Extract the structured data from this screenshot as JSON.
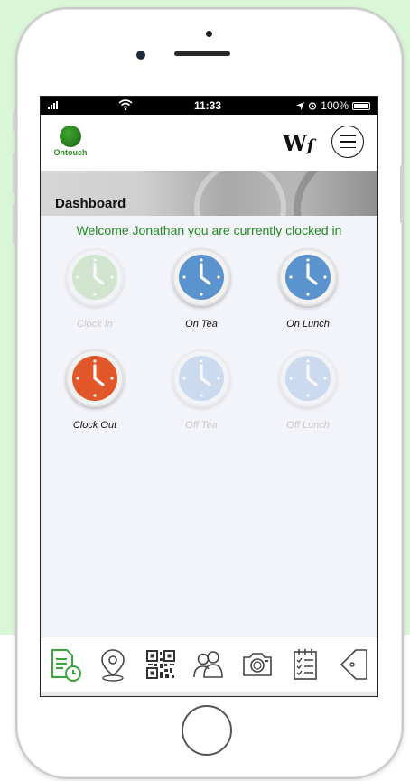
{
  "status_bar": {
    "time": "11:33",
    "battery": "100%"
  },
  "header": {
    "logo_text": "Ontouch",
    "brand_mark": "W",
    "menu_icon": "hamburger-menu-icon"
  },
  "banner": {
    "title": "Dashboard"
  },
  "welcome": "Welcome Jonathan you are currently clocked in",
  "actions": [
    {
      "label": "Clock In",
      "color": "#a9d49b",
      "enabled": false
    },
    {
      "label": "On Tea",
      "color": "#5b93cf",
      "enabled": true
    },
    {
      "label": "On Lunch",
      "color": "#5b93cf",
      "enabled": true
    },
    {
      "label": "Clock Out",
      "color": "#e1572a",
      "enabled": true
    },
    {
      "label": "Off Tea",
      "color": "#9cbce3",
      "enabled": false
    },
    {
      "label": "Off Lunch",
      "color": "#9cbce3",
      "enabled": false
    }
  ],
  "tabbar": {
    "items": [
      {
        "icon": "timesheet-clock-icon",
        "active": true
      },
      {
        "icon": "location-pin-icon",
        "active": false
      },
      {
        "icon": "qr-code-icon",
        "active": false
      },
      {
        "icon": "users-icon",
        "active": false
      },
      {
        "icon": "camera-icon",
        "active": false
      },
      {
        "icon": "checklist-icon",
        "active": false
      },
      {
        "icon": "tag-icon",
        "active": false
      }
    ]
  },
  "colors": {
    "accent_green": "#1f8a1f",
    "page_background": "#d9f6d6",
    "screen_background": "#f3f4fa"
  }
}
